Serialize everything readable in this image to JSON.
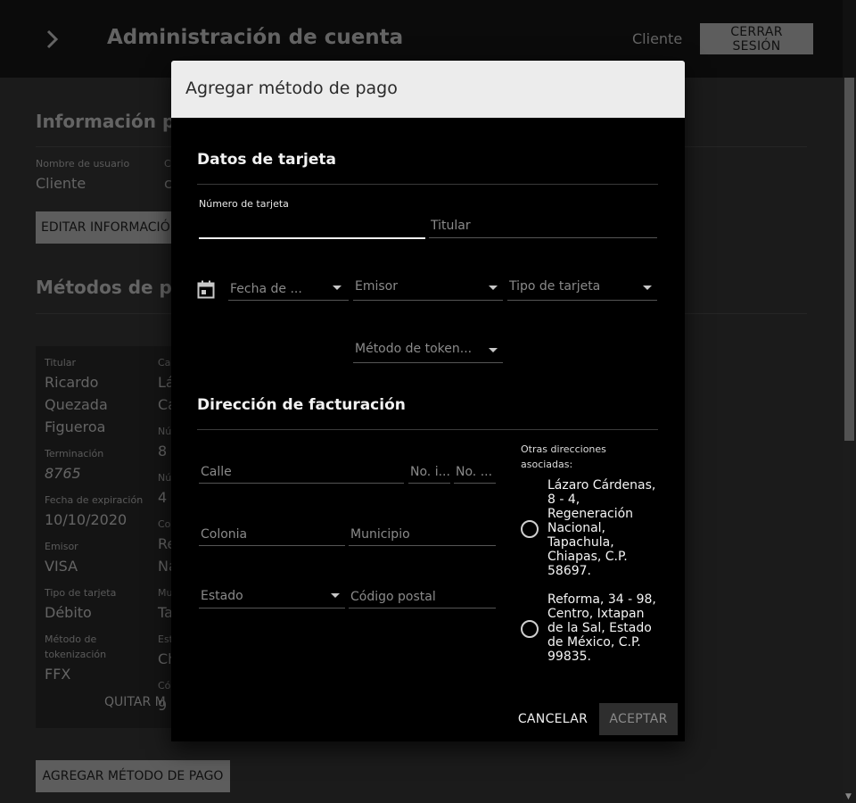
{
  "appbar": {
    "title": "Administración de cuenta",
    "user": "Cliente",
    "logout_label": "CERRAR SESIÓN"
  },
  "background": {
    "info_title": "Información p",
    "username_label": "Nombre de usuario",
    "username_value": "Cliente",
    "col2_label": "C",
    "col2_value": "c",
    "edit_button": "EDITAR INFORMACIÓ",
    "methods_title": "Métodos de p",
    "card": {
      "holder_label": "Titular",
      "holder_line1": "Ricardo",
      "holder_line2": "Quezada",
      "holder_line3": "Figueroa",
      "termination_label": "Terminación",
      "termination_value": "8765",
      "expiry_label": "Fecha de expiración",
      "expiry_value": "10/10/2020",
      "issuer_label": "Emisor",
      "issuer_value": "VISA",
      "type_label": "Tipo de tarjeta",
      "type_value": "Débito",
      "token_label_1": "Método de",
      "token_label_2": "tokenización",
      "token_value": "FFX",
      "remove_button": "QUITAR M",
      "col2": {
        "l1": "Ca",
        "v1a": "Lá",
        "v1b": "Ca",
        "l2": "Nú",
        "v2": "8",
        "l3": "Nú",
        "v3": "4",
        "l4": "Co",
        "v4a": "Re",
        "v4b": "Na",
        "l5": "Mu",
        "v5": "Ta",
        "l6": "Est",
        "v6": "Ch",
        "l7": "Có",
        "v7": "9"
      }
    },
    "add_button": "AGREGAR MÉTODO DE PAGO"
  },
  "dialog": {
    "title": "Agregar método de pago",
    "card_section": "Datos de tarjeta",
    "card_number_label": "Número de tarjeta",
    "holder_placeholder": "Titular",
    "expiry_placeholder": "Fecha de ...",
    "issuer_placeholder": "Emisor",
    "card_type_placeholder": "Tipo de tarjeta",
    "token_placeholder": "Método de token...",
    "billing_section": "Dirección de facturación",
    "street_placeholder": "Calle",
    "ext_no_placeholder": "No. i...",
    "int_no_placeholder": "No. ...",
    "colonia_placeholder": "Colonia",
    "municipio_placeholder": "Municipio",
    "estado_placeholder": "Estado",
    "cp_placeholder": "Código postal",
    "other_addresses_label": "Otras direcciones asociadas:",
    "addresses": [
      "Lázaro Cárdenas, 8 - 4, Regeneración Nacional, Tapachula, Chiapas, C.P. 58697.",
      "Reforma, 34 - 98, Centro, Ixtapan de la Sal, Estado de México, C.P. 99835."
    ],
    "cancel_label": "CANCELAR",
    "accept_label": "ACEPTAR"
  }
}
